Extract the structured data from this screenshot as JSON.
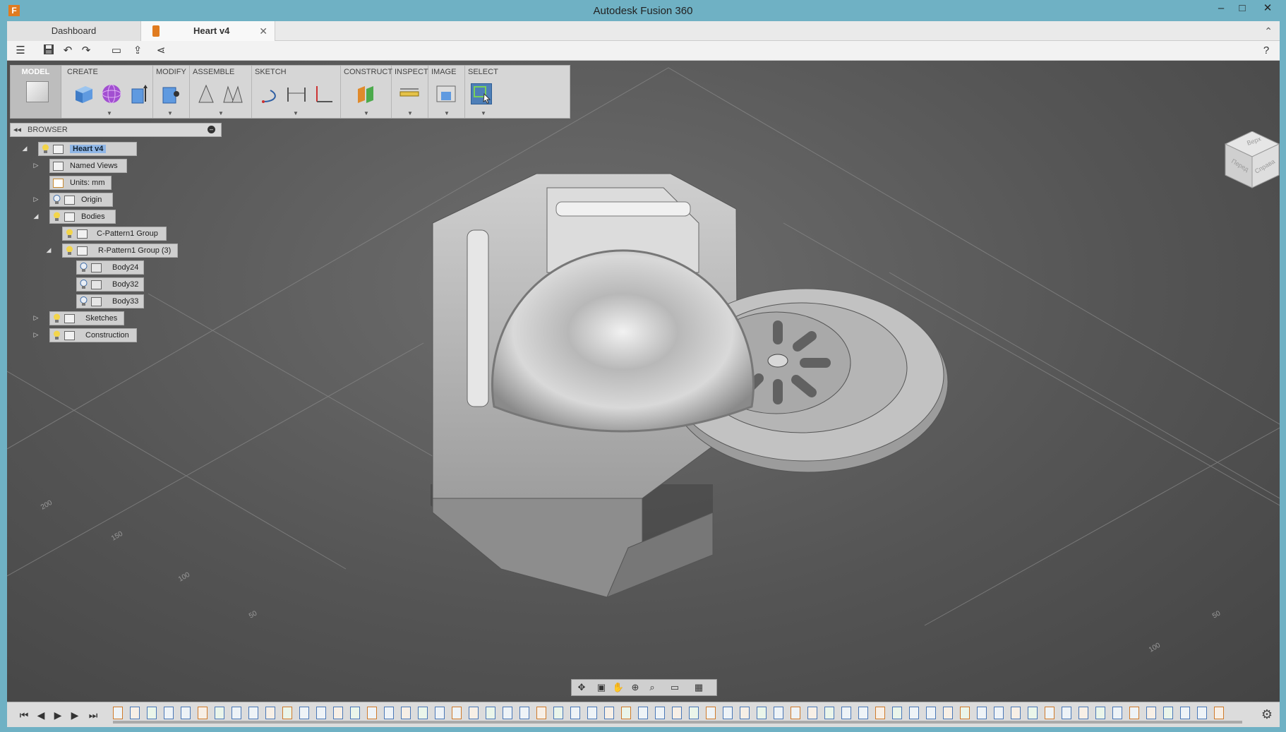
{
  "window": {
    "title": "Autodesk Fusion 360",
    "app_icon": "F",
    "minimize": "–",
    "maximize": "□",
    "close": "✕"
  },
  "tabs": [
    {
      "label": "Dashboard"
    },
    {
      "label": "Heart v4",
      "close": "✕"
    }
  ],
  "quick_access": {
    "menu": "☰",
    "save": "💾",
    "undo": "↶",
    "redo": "↷",
    "help": "?"
  },
  "toolbar": {
    "workspace": "MODEL",
    "groups": [
      "CREATE",
      "MODIFY",
      "ASSEMBLE",
      "SKETCH",
      "CONSTRUCT",
      "INSPECT",
      "IMAGE",
      "SELECT"
    ]
  },
  "browser": {
    "title": "BROWSER",
    "nodes": [
      {
        "label": "Heart v4"
      },
      {
        "label": "Named Views"
      },
      {
        "label": "Units: mm"
      },
      {
        "label": "Origin"
      },
      {
        "label": "Bodies"
      },
      {
        "label": "C-Pattern1 Group"
      },
      {
        "label": "R-Pattern1 Group (3)"
      },
      {
        "label": "Body24"
      },
      {
        "label": "Body32"
      },
      {
        "label": "Body33"
      },
      {
        "label": "Sketches"
      },
      {
        "label": "Construction"
      }
    ]
  },
  "viewcube": {
    "faces": [
      "Верх",
      "Перед",
      "Справа"
    ]
  },
  "grid_labels": [
    "200",
    "150",
    "100",
    "50",
    "100",
    "50"
  ],
  "colors": {
    "accent": "#e07b1f",
    "viewport": "#555555",
    "selection": "#5a8fd6"
  }
}
